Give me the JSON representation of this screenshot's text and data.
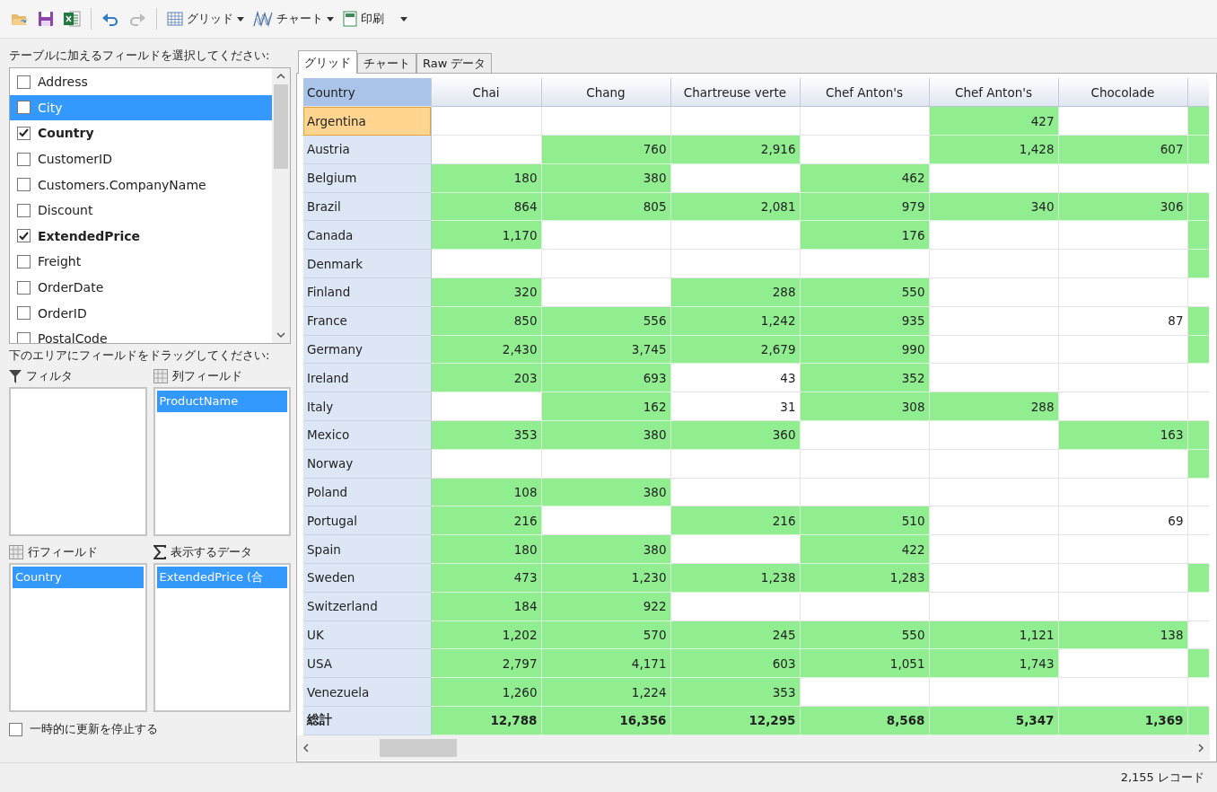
{
  "toolbar": {
    "icon_buttons": [
      {
        "disabled": false
      },
      {
        "disabled": false
      },
      {
        "disabled": false
      },
      {
        "disabled": false
      },
      {
        "disabled": true
      }
    ],
    "menus": [
      {
        "label": "グリッド"
      },
      {
        "label": "チャート"
      },
      {
        "label": "印刷"
      }
    ]
  },
  "fields": {
    "title": "テーブルに加えるフィールドを選択してください:",
    "items": [
      {
        "label": "Address",
        "checked": false,
        "selected": false
      },
      {
        "label": "City",
        "checked": false,
        "selected": true
      },
      {
        "label": "Country",
        "checked": true,
        "selected": false
      },
      {
        "label": "CustomerID",
        "checked": false,
        "selected": false
      },
      {
        "label": "Customers.CompanyName",
        "checked": false,
        "selected": false
      },
      {
        "label": "Discount",
        "checked": false,
        "selected": false
      },
      {
        "label": "ExtendedPrice",
        "checked": true,
        "selected": false
      },
      {
        "label": "Freight",
        "checked": false,
        "selected": false
      },
      {
        "label": "OrderDate",
        "checked": false,
        "selected": false
      },
      {
        "label": "OrderID",
        "checked": false,
        "selected": false
      },
      {
        "label": "PostalCode",
        "checked": false,
        "selected": false
      }
    ]
  },
  "areas": {
    "title": "下のエリアにフィールドをドラッグしてください:",
    "zones": [
      {
        "title": "フィルタ"
      },
      {
        "title": "列フィールド",
        "items": [
          {
            "label": "ProductName",
            "selected": true
          }
        ]
      },
      {
        "title": "行フィールド",
        "items": [
          {
            "label": "Country",
            "selected": true
          }
        ]
      },
      {
        "title": "表示するデータ",
        "items": [
          {
            "label": "ExtendedPrice (合",
            "selected": true
          }
        ]
      }
    ]
  },
  "suspend_updates": {
    "label": "一時的に更新を停止する",
    "checked": false
  },
  "tabs": [
    {
      "label": "グリッド",
      "selected": true
    },
    {
      "label": "チャート",
      "selected": false
    },
    {
      "label": "Raw データ",
      "selected": false
    }
  ],
  "grid": {
    "corner": "Country",
    "columns": [
      "Chai",
      "Chang",
      "Chartreuse verte",
      "Chef Anton's",
      "Chef Anton's",
      "Chocolade"
    ],
    "rows": [
      {
        "label": "Argentina",
        "selected": true,
        "cells": [
          {
            "highlighted": false
          },
          {
            "highlighted": false
          },
          {
            "highlighted": false
          },
          {
            "highlighted": false
          },
          {
            "text": "427",
            "highlighted": true
          },
          {
            "highlighted": false
          },
          {
            "highlighted": true
          }
        ]
      },
      {
        "label": "Austria",
        "selected": false,
        "cells": [
          {
            "highlighted": false
          },
          {
            "text": "760",
            "highlighted": true
          },
          {
            "text": "2,916",
            "highlighted": true
          },
          {
            "highlighted": false
          },
          {
            "text": "1,428",
            "highlighted": true
          },
          {
            "text": "607",
            "highlighted": true
          },
          {
            "highlighted": true
          }
        ]
      },
      {
        "label": "Belgium",
        "selected": false,
        "cells": [
          {
            "text": "180",
            "highlighted": true
          },
          {
            "text": "380",
            "highlighted": true
          },
          {
            "highlighted": false
          },
          {
            "text": "462",
            "highlighted": true
          },
          {
            "highlighted": false
          },
          {
            "highlighted": false
          },
          {
            "highlighted": false
          }
        ]
      },
      {
        "label": "Brazil",
        "selected": false,
        "cells": [
          {
            "text": "864",
            "highlighted": true
          },
          {
            "text": "805",
            "highlighted": true
          },
          {
            "text": "2,081",
            "highlighted": true
          },
          {
            "text": "979",
            "highlighted": true
          },
          {
            "text": "340",
            "highlighted": true
          },
          {
            "text": "306",
            "highlighted": true
          },
          {
            "highlighted": true
          }
        ]
      },
      {
        "label": "Canada",
        "selected": false,
        "cells": [
          {
            "text": "1,170",
            "highlighted": true
          },
          {
            "highlighted": false
          },
          {
            "highlighted": false
          },
          {
            "text": "176",
            "highlighted": true
          },
          {
            "highlighted": false
          },
          {
            "highlighted": false
          },
          {
            "highlighted": true
          }
        ]
      },
      {
        "label": "Denmark",
        "selected": false,
        "cells": [
          {
            "highlighted": false
          },
          {
            "highlighted": false
          },
          {
            "highlighted": false
          },
          {
            "highlighted": false
          },
          {
            "highlighted": false
          },
          {
            "highlighted": false
          },
          {
            "highlighted": true
          }
        ]
      },
      {
        "label": "Finland",
        "selected": false,
        "cells": [
          {
            "text": "320",
            "highlighted": true
          },
          {
            "highlighted": false
          },
          {
            "text": "288",
            "highlighted": true
          },
          {
            "text": "550",
            "highlighted": true
          },
          {
            "highlighted": false
          },
          {
            "highlighted": false
          },
          {
            "highlighted": false
          }
        ]
      },
      {
        "label": "France",
        "selected": false,
        "cells": [
          {
            "text": "850",
            "highlighted": true
          },
          {
            "text": "556",
            "highlighted": true
          },
          {
            "text": "1,242",
            "highlighted": true
          },
          {
            "text": "935",
            "highlighted": true
          },
          {
            "highlighted": false
          },
          {
            "text": "87",
            "highlighted": false
          },
          {
            "highlighted": true
          }
        ]
      },
      {
        "label": "Germany",
        "selected": false,
        "cells": [
          {
            "text": "2,430",
            "highlighted": true
          },
          {
            "text": "3,745",
            "highlighted": true
          },
          {
            "text": "2,679",
            "highlighted": true
          },
          {
            "text": "990",
            "highlighted": true
          },
          {
            "highlighted": false
          },
          {
            "highlighted": false
          },
          {
            "highlighted": true
          }
        ]
      },
      {
        "label": "Ireland",
        "selected": false,
        "cells": [
          {
            "text": "203",
            "highlighted": true
          },
          {
            "text": "693",
            "highlighted": true
          },
          {
            "text": "43",
            "highlighted": false
          },
          {
            "text": "352",
            "highlighted": true
          },
          {
            "highlighted": false
          },
          {
            "highlighted": false
          },
          {
            "highlighted": false
          }
        ]
      },
      {
        "label": "Italy",
        "selected": false,
        "cells": [
          {
            "highlighted": false
          },
          {
            "text": "162",
            "highlighted": true
          },
          {
            "text": "31",
            "highlighted": false
          },
          {
            "text": "308",
            "highlighted": true
          },
          {
            "text": "288",
            "highlighted": true
          },
          {
            "highlighted": false
          },
          {
            "highlighted": false
          }
        ]
      },
      {
        "label": "Mexico",
        "selected": false,
        "cells": [
          {
            "text": "353",
            "highlighted": true
          },
          {
            "text": "380",
            "highlighted": true
          },
          {
            "text": "360",
            "highlighted": true
          },
          {
            "highlighted": false
          },
          {
            "highlighted": false
          },
          {
            "text": "163",
            "highlighted": true
          },
          {
            "highlighted": true
          }
        ]
      },
      {
        "label": "Norway",
        "selected": false,
        "cells": [
          {
            "highlighted": false
          },
          {
            "highlighted": false
          },
          {
            "highlighted": false
          },
          {
            "highlighted": false
          },
          {
            "highlighted": false
          },
          {
            "highlighted": false
          },
          {
            "highlighted": true
          }
        ]
      },
      {
        "label": "Poland",
        "selected": false,
        "cells": [
          {
            "text": "108",
            "highlighted": true
          },
          {
            "text": "380",
            "highlighted": true
          },
          {
            "highlighted": false
          },
          {
            "highlighted": false
          },
          {
            "highlighted": false
          },
          {
            "highlighted": false
          },
          {
            "highlighted": false
          }
        ]
      },
      {
        "label": "Portugal",
        "selected": false,
        "cells": [
          {
            "text": "216",
            "highlighted": true
          },
          {
            "highlighted": false
          },
          {
            "text": "216",
            "highlighted": true
          },
          {
            "text": "510",
            "highlighted": true
          },
          {
            "highlighted": false
          },
          {
            "text": "69",
            "highlighted": false
          },
          {
            "highlighted": false
          }
        ]
      },
      {
        "label": "Spain",
        "selected": false,
        "cells": [
          {
            "text": "180",
            "highlighted": true
          },
          {
            "text": "380",
            "highlighted": true
          },
          {
            "highlighted": false
          },
          {
            "text": "422",
            "highlighted": true
          },
          {
            "highlighted": false
          },
          {
            "highlighted": false
          },
          {
            "highlighted": false
          }
        ]
      },
      {
        "label": "Sweden",
        "selected": false,
        "cells": [
          {
            "text": "473",
            "highlighted": true
          },
          {
            "text": "1,230",
            "highlighted": true
          },
          {
            "text": "1,238",
            "highlighted": true
          },
          {
            "text": "1,283",
            "highlighted": true
          },
          {
            "highlighted": false
          },
          {
            "highlighted": false
          },
          {
            "highlighted": true
          }
        ]
      },
      {
        "label": "Switzerland",
        "selected": false,
        "cells": [
          {
            "text": "184",
            "highlighted": true
          },
          {
            "text": "922",
            "highlighted": true
          },
          {
            "highlighted": false
          },
          {
            "highlighted": false
          },
          {
            "highlighted": false
          },
          {
            "highlighted": false
          },
          {
            "highlighted": false
          }
        ]
      },
      {
        "label": "UK",
        "selected": false,
        "cells": [
          {
            "text": "1,202",
            "highlighted": true
          },
          {
            "text": "570",
            "highlighted": true
          },
          {
            "text": "245",
            "highlighted": true
          },
          {
            "text": "550",
            "highlighted": true
          },
          {
            "text": "1,121",
            "highlighted": true
          },
          {
            "text": "138",
            "highlighted": true
          },
          {
            "highlighted": false
          }
        ]
      },
      {
        "label": "USA",
        "selected": false,
        "cells": [
          {
            "text": "2,797",
            "highlighted": true
          },
          {
            "text": "4,171",
            "highlighted": true
          },
          {
            "text": "603",
            "highlighted": true
          },
          {
            "text": "1,051",
            "highlighted": true
          },
          {
            "text": "1,743",
            "highlighted": true
          },
          {
            "highlighted": false
          },
          {
            "highlighted": true
          }
        ]
      },
      {
        "label": "Venezuela",
        "selected": false,
        "cells": [
          {
            "text": "1,260",
            "highlighted": true
          },
          {
            "text": "1,224",
            "highlighted": true
          },
          {
            "text": "353",
            "highlighted": true
          },
          {
            "highlighted": false
          },
          {
            "highlighted": false
          },
          {
            "highlighted": false
          },
          {
            "highlighted": false
          }
        ]
      }
    ],
    "total": {
      "label": "総計",
      "cells": [
        {
          "text": "12,788",
          "highlighted": true
        },
        {
          "text": "16,356",
          "highlighted": true
        },
        {
          "text": "12,295",
          "highlighted": true
        },
        {
          "text": "8,568",
          "highlighted": true
        },
        {
          "text": "5,347",
          "highlighted": true
        },
        {
          "text": "1,369",
          "highlighted": true
        },
        {
          "highlighted": true
        }
      ]
    }
  },
  "status_bar": {
    "record_count": "2,155 レコード"
  }
}
